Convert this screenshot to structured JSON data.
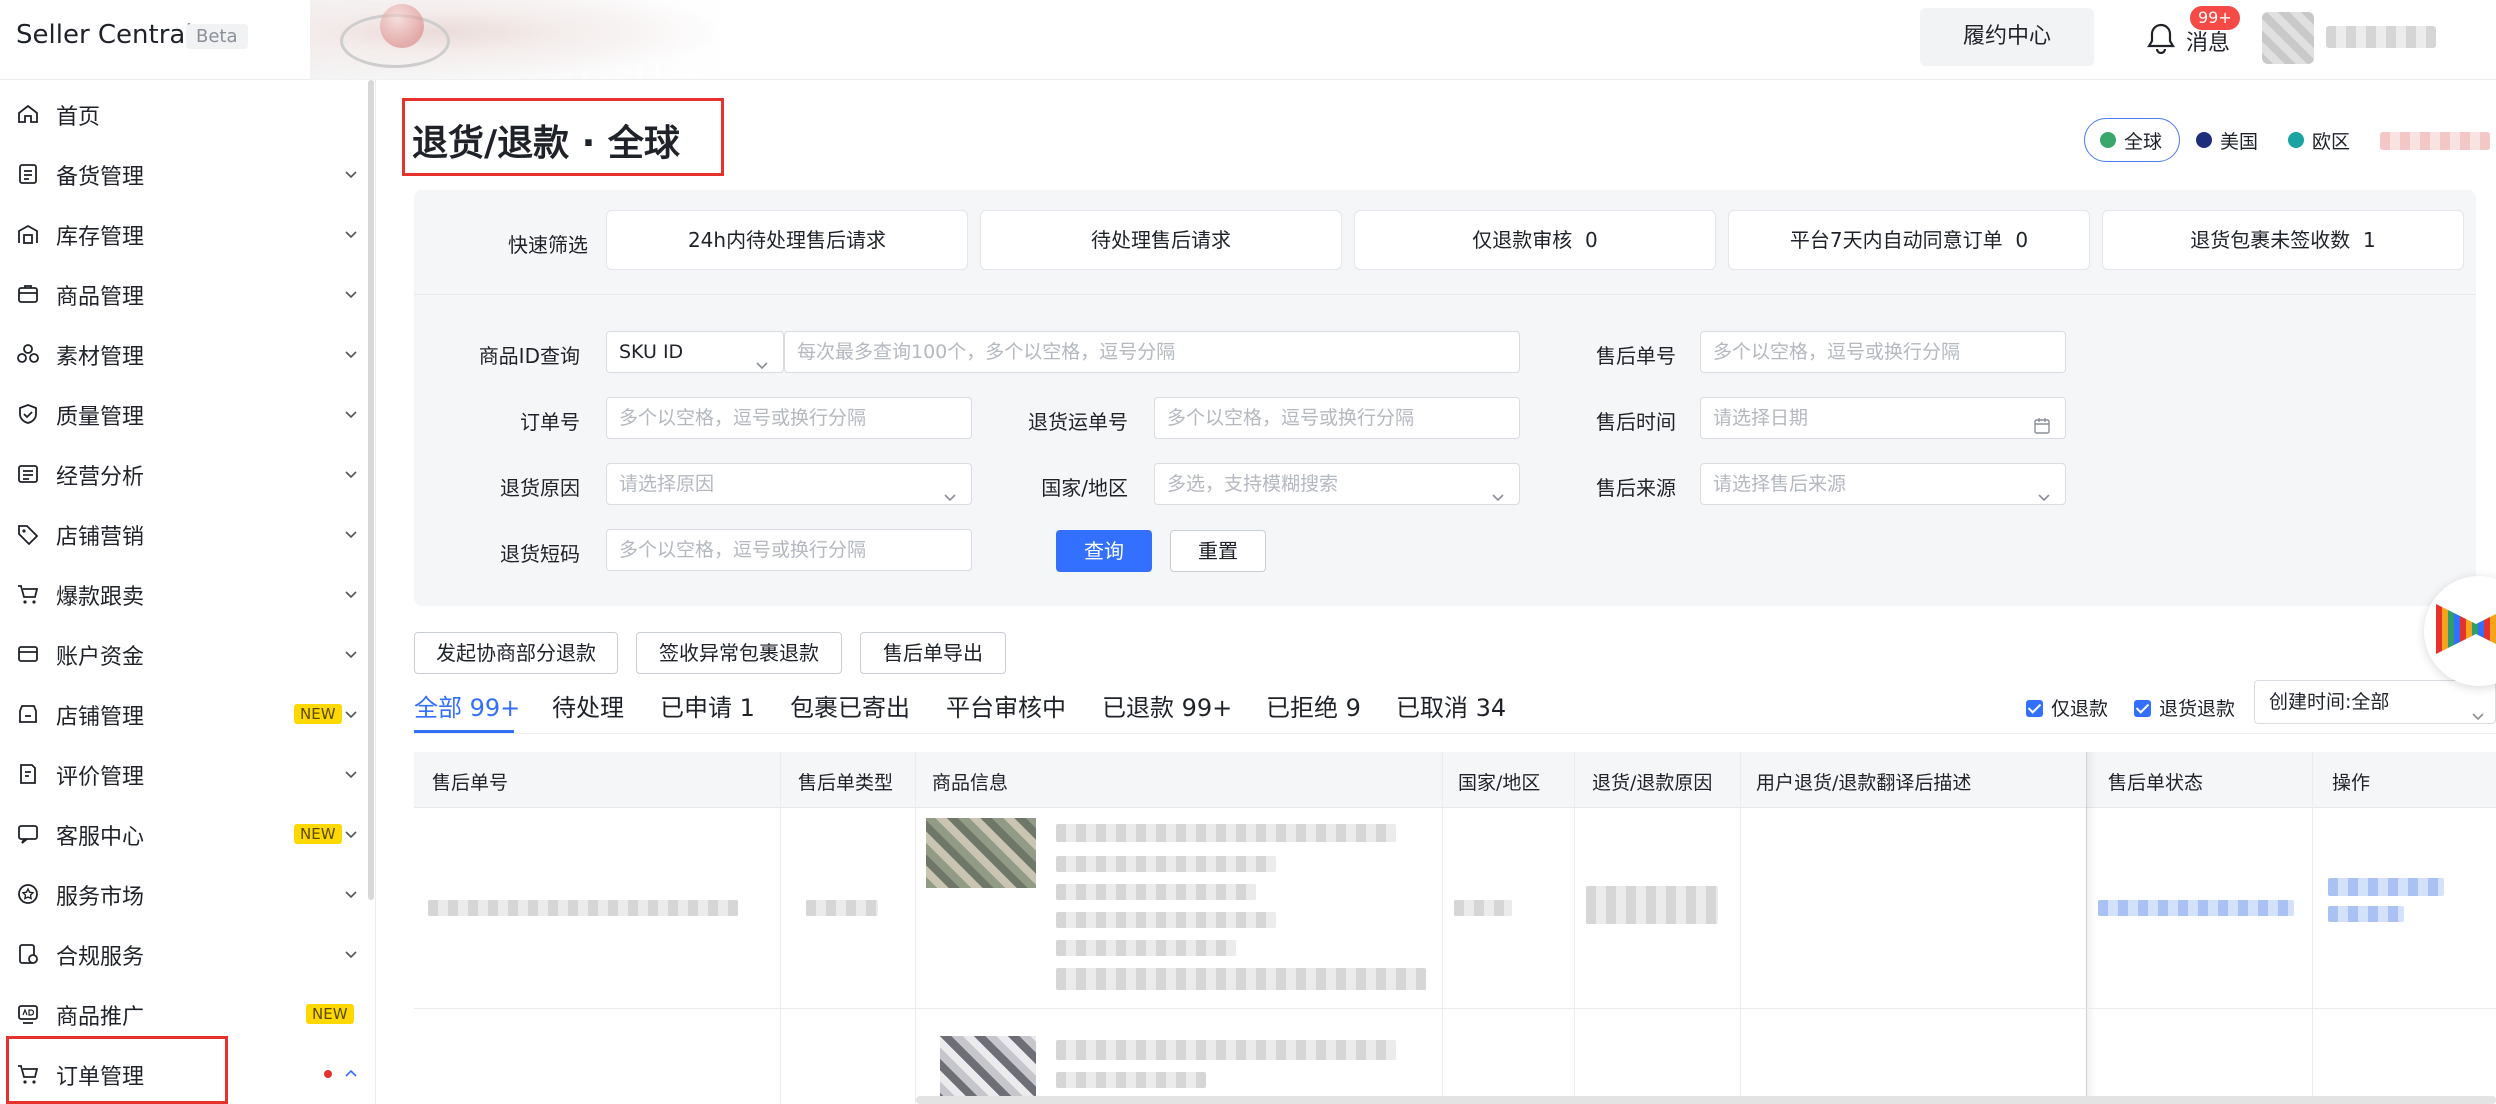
{
  "header": {
    "brand": "Seller Central",
    "beta": "Beta",
    "fulfillment_center": "履约中心",
    "messages_label": "消息",
    "messages_badge": "99+"
  },
  "sidebar": {
    "items": [
      {
        "label": "首页",
        "icon": "home-icon"
      },
      {
        "label": "备货管理",
        "icon": "clipboard-icon"
      },
      {
        "label": "库存管理",
        "icon": "warehouse-icon"
      },
      {
        "label": "商品管理",
        "icon": "box-icon"
      },
      {
        "label": "素材管理",
        "icon": "shapes-icon"
      },
      {
        "label": "质量管理",
        "icon": "shield-check-icon"
      },
      {
        "label": "经营分析",
        "icon": "list-chart-icon"
      },
      {
        "label": "店铺营销",
        "icon": "tag-icon"
      },
      {
        "label": "爆款跟卖",
        "icon": "cart-follow-icon"
      },
      {
        "label": "账户资金",
        "icon": "wallet-icon"
      },
      {
        "label": "店铺管理",
        "icon": "store-icon",
        "tag": "NEW"
      },
      {
        "label": "评价管理",
        "icon": "review-icon"
      },
      {
        "label": "客服中心",
        "icon": "chat-icon",
        "tag": "NEW"
      },
      {
        "label": "服务市场",
        "icon": "service-icon"
      },
      {
        "label": "合规服务",
        "icon": "compliance-icon"
      },
      {
        "label": "商品推广",
        "icon": "ad-icon",
        "tag": "NEW"
      },
      {
        "label": "订单管理",
        "icon": "shopping-cart-icon"
      }
    ]
  },
  "page": {
    "title": "退货/退款 · 全球",
    "regions": [
      "全球",
      "美国",
      "欧区"
    ],
    "region_colors": {
      "global": "#3aa76d",
      "us": "#1f2d7a",
      "eu": "#1aa3a0"
    }
  },
  "quick_filter": {
    "label": "快速筛选",
    "cards": [
      {
        "label": "24h内待处理售后请求",
        "count": ""
      },
      {
        "label": "待处理售后请求",
        "count": ""
      },
      {
        "label": "仅退款审核",
        "count": "0"
      },
      {
        "label": "平台7天内自动同意订单",
        "count": "0"
      },
      {
        "label": "退货包裹未签收数",
        "count": "1"
      }
    ]
  },
  "filters": {
    "product_id_label": "商品ID查询",
    "product_id_type": "SKU ID",
    "product_id_placeholder": "每次最多查询100个，多个以空格，逗号分隔",
    "after_sale_no_label": "售后单号",
    "after_sale_no_placeholder": "多个以空格，逗号或换行分隔",
    "order_no_label": "订单号",
    "order_no_placeholder": "多个以空格，逗号或换行分隔",
    "return_tracking_label": "退货运单号",
    "return_tracking_placeholder": "多个以空格，逗号或换行分隔",
    "after_sale_time_label": "售后时间",
    "after_sale_time_placeholder": "请选择日期",
    "return_reason_label": "退货原因",
    "return_reason_placeholder": "请选择原因",
    "country_label": "国家/地区",
    "country_placeholder": "多选，支持模糊搜索",
    "source_label": "售后来源",
    "source_placeholder": "请选择售后来源",
    "return_code_label": "退货短码",
    "return_code_placeholder": "多个以空格，逗号或换行分隔",
    "query_button": "查询",
    "reset_button": "重置"
  },
  "actions": [
    "发起协商部分退款",
    "签收异常包裹退款",
    "售后单导出"
  ],
  "tabs": [
    {
      "label": "全部",
      "count": "99+"
    },
    {
      "label": "待处理",
      "count": ""
    },
    {
      "label": "已申请",
      "count": "1"
    },
    {
      "label": "包裹已寄出",
      "count": ""
    },
    {
      "label": "平台审核中",
      "count": ""
    },
    {
      "label": "已退款",
      "count": "99+"
    },
    {
      "label": "已拒绝",
      "count": "9"
    },
    {
      "label": "已取消",
      "count": "34"
    }
  ],
  "toggles": {
    "refund_only": "仅退款",
    "return_refund": "退货退款",
    "sort": "创建时间:全部"
  },
  "table": {
    "columns": [
      "售后单号",
      "售后单类型",
      "商品信息",
      "国家/地区",
      "退货/退款原因",
      "用户退货/退款翻译后描述",
      "售后单状态",
      "操作"
    ]
  },
  "colors": {
    "accent": "#3370ff",
    "highlight": "#e5322d",
    "new_tag": "#ffd800"
  }
}
